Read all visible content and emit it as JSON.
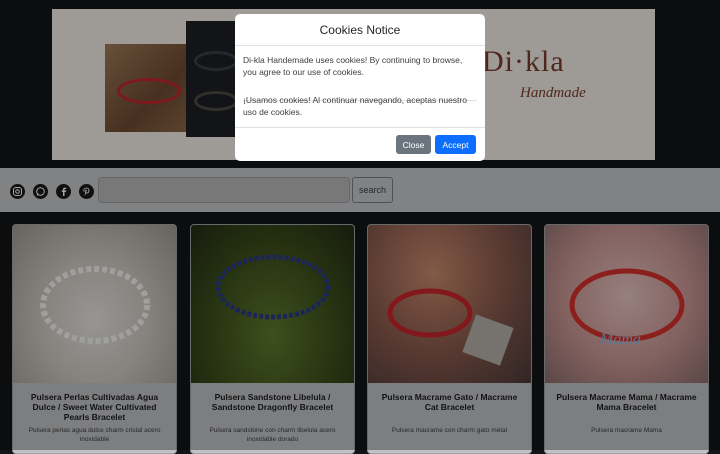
{
  "banner": {
    "logo_text": "Di·kla",
    "logo_sub": "Handmade"
  },
  "social": {
    "icons": [
      "instagram-icon",
      "whatsapp-icon",
      "facebook-icon",
      "pinterest-icon"
    ]
  },
  "search": {
    "placeholder": "",
    "button_label": "search"
  },
  "products": [
    {
      "title": "Pulsera Perlas Cultivadas Agua Dulce / Sweet Water Cultivated Pearls Bracelet",
      "desc": "Pulsera perlas agua dulce charm cristal acero inoxidable"
    },
    {
      "title": "Pulsera Sandstone Libelula / Sandstone Dragonfly Bracelet",
      "desc": "Pulsera sandstone con charm libelula acero inoxidable dorado"
    },
    {
      "title": "Pulsera Macrame Gato / Macrame Cat Bracelet",
      "desc": "Pulsera macrame con charm gato metal"
    },
    {
      "title": "Pulsera Macrame Mama / Macrame Mama Bracelet",
      "desc": "Pulsera macrame Mama"
    }
  ],
  "modal": {
    "title": "Cookies Notice",
    "text_en": "Di-kla Handemade uses cookies! By continuing to browse, you agree to our use of cookies.",
    "text_es": "¡Usamos cookies! Al continuar navegando, aceptas nuestro uso de cookies.",
    "close_label": "Close",
    "accept_label": "Accept"
  },
  "colors": {
    "accept": "#0d6efd",
    "close": "#6c757d",
    "brand": "#7c3b2b"
  }
}
